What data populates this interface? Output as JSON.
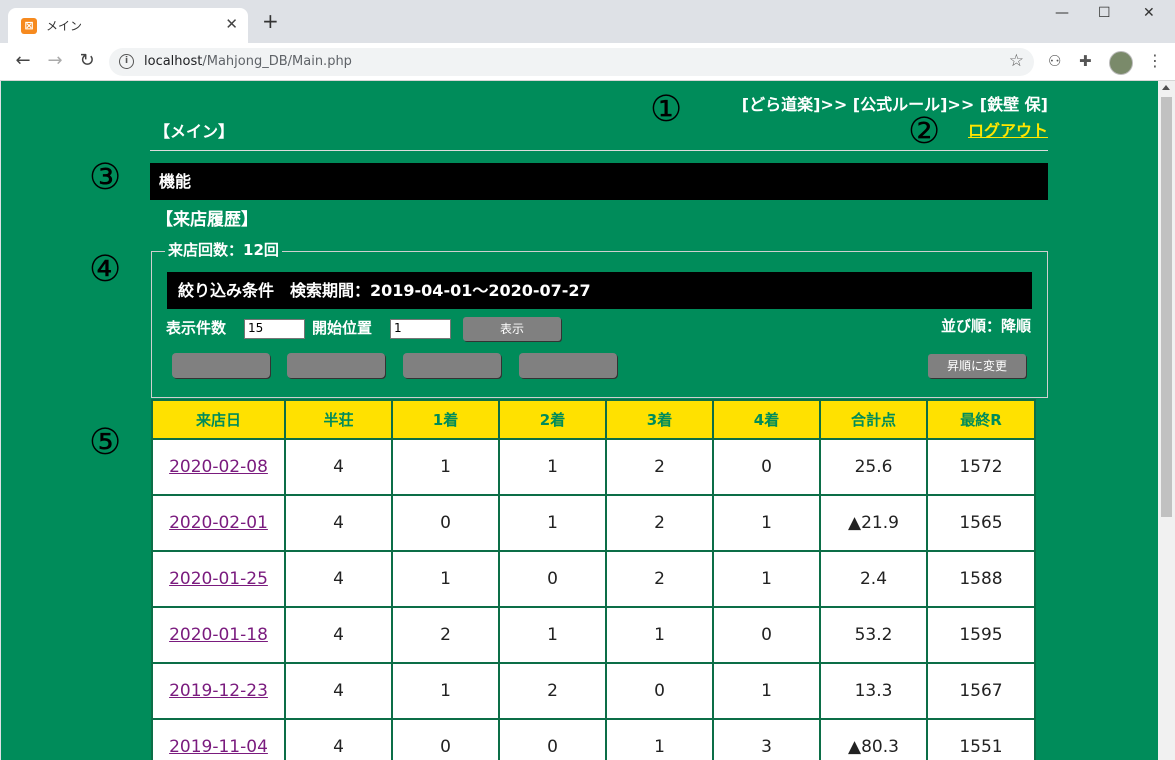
{
  "browser": {
    "tab_title": "メイン",
    "tab_favicon": "xampp-icon",
    "url_host": "localhost",
    "url_path": "/Mahjong_DB/Main.php"
  },
  "header": {
    "breadcrumb": "[どら道楽]>> [公式ルール]>> [鉄壁 保]",
    "logout_label": "ログアウト",
    "page_title": "【メイン】"
  },
  "function_bar": {
    "label": "機能"
  },
  "history": {
    "section_title": "【来店履歴】",
    "visit_count_label": "来店回数：12回",
    "filter_label": "絞り込み条件　検索期間：2019-04-01～2020-07-27",
    "display_count_label": "表示件数",
    "display_count_value": "15",
    "start_pos_label": "開始位置",
    "start_pos_value": "1",
    "show_button": "表示",
    "sort_label": "並び順：降順",
    "sort_toggle_button": "昇順に変更"
  },
  "markers": [
    "①",
    "②",
    "③",
    "④",
    "⑤"
  ],
  "table": {
    "columns": [
      "来店日",
      "半荘",
      "1着",
      "2着",
      "3着",
      "4着",
      "合計点",
      "最終R"
    ],
    "rows": [
      {
        "date": "2020-02-08",
        "games": "4",
        "p1": "1",
        "p2": "1",
        "p3": "2",
        "p4": "0",
        "total": "25.6",
        "negative": false,
        "rating": "1572"
      },
      {
        "date": "2020-02-01",
        "games": "4",
        "p1": "0",
        "p2": "1",
        "p3": "2",
        "p4": "1",
        "total": "▲21.9",
        "negative": true,
        "rating": "1565"
      },
      {
        "date": "2020-01-25",
        "games": "4",
        "p1": "1",
        "p2": "0",
        "p3": "2",
        "p4": "1",
        "total": "2.4",
        "negative": false,
        "rating": "1588"
      },
      {
        "date": "2020-01-18",
        "games": "4",
        "p1": "2",
        "p2": "1",
        "p3": "1",
        "p4": "0",
        "total": "53.2",
        "negative": false,
        "rating": "1595"
      },
      {
        "date": "2019-12-23",
        "games": "4",
        "p1": "1",
        "p2": "2",
        "p3": "0",
        "p4": "1",
        "total": "13.3",
        "negative": false,
        "rating": "1567"
      },
      {
        "date": "2019-11-04",
        "games": "4",
        "p1": "0",
        "p2": "0",
        "p3": "1",
        "p4": "3",
        "total": "▲80.3",
        "negative": true,
        "rating": "1551"
      }
    ]
  }
}
